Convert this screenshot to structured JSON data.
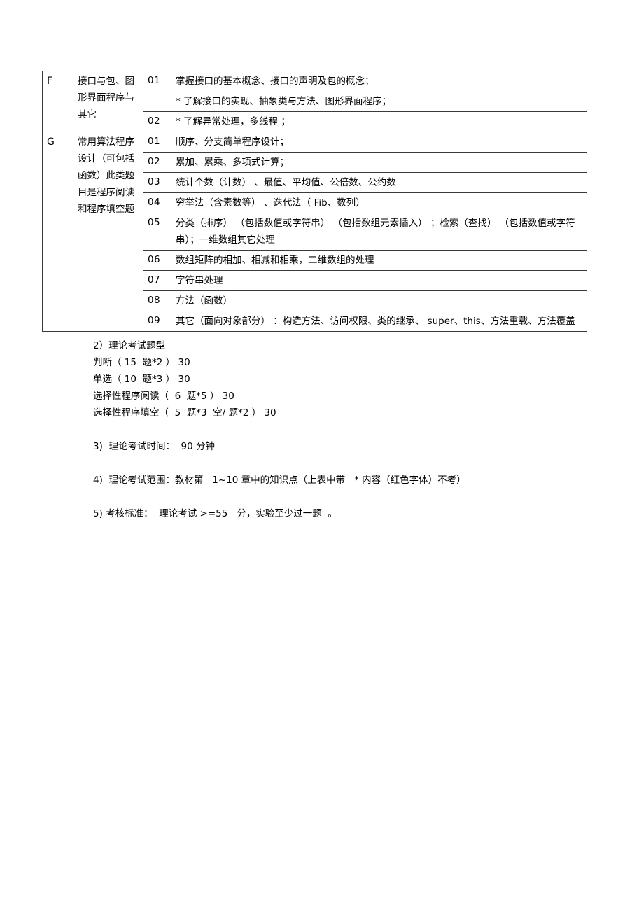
{
  "document": {
    "table": {
      "sections": [
        {
          "letter": "F",
          "topic": "接口与包、图形界面程序与其它",
          "rows": [
            {
              "num": "01",
              "lines": [
                "掌握接口的基本概念、接口的声明及包的概念；",
                "* 了解接口的实现、抽象类与方法、图形界面程序；"
              ]
            },
            {
              "num": "02",
              "lines": [
                "* 了解异常处理，多线程    ；"
              ]
            }
          ]
        },
        {
          "letter": "G",
          "topic": "常用算法程序设计（可包括函数）此类题目是程序阅读和程序填空题",
          "rows": [
            {
              "num": "01",
              "lines": [
                "顺序、分支简单程序设计；"
              ]
            },
            {
              "num": "02",
              "lines": [
                "累加、累乘、多项式计算；"
              ]
            },
            {
              "num": "03",
              "lines": [
                "统计个数（计数） 、最值、平均值、公倍数、公约数"
              ]
            },
            {
              "num": "04",
              "lines": [
                "穷举法（含素数等） 、迭代法（ Fib、数列）"
              ]
            },
            {
              "num": "05",
              "lines": [
                "分类（排序） （包括数值或字符串）  （包括数组元素插入） ；检索（查找） （包括数值或字符串）；一维数组其它处理"
              ]
            },
            {
              "num": "06",
              "lines": [
                "数组矩阵的相加、相减和相乘，二维数组的处理"
              ]
            },
            {
              "num": "07",
              "lines": [
                "字符串处理"
              ]
            },
            {
              "num": "08",
              "lines": [
                "方法（函数）"
              ]
            },
            {
              "num": "09",
              "lines": [
                "其它（面向对象部分） ：构造方法、访问权限、类的继承、    super、this、方法重载、方法覆盖"
              ]
            }
          ]
        }
      ]
    },
    "sections_text": {
      "item2": {
        "heading": "2）理论考试题型",
        "lines": [
          "判断（ 15  题*2 ） 30",
          "单选（ 10  题*3 ） 30",
          "选择性程序阅读（  6  题*5 ） 30",
          "选择性程序填空（  5  题*3  空/ 题*2 ） 30"
        ]
      },
      "item3": "3)  理论考试时间：  90 分钟",
      "item4": "4)  理论考试范围：教材第   1~10 章中的知识点（上表中带   * 内容（红色字体）不考）",
      "item5": "5) 考核标准：  理论考试 >=55   分，实验至少过一题  。"
    }
  }
}
